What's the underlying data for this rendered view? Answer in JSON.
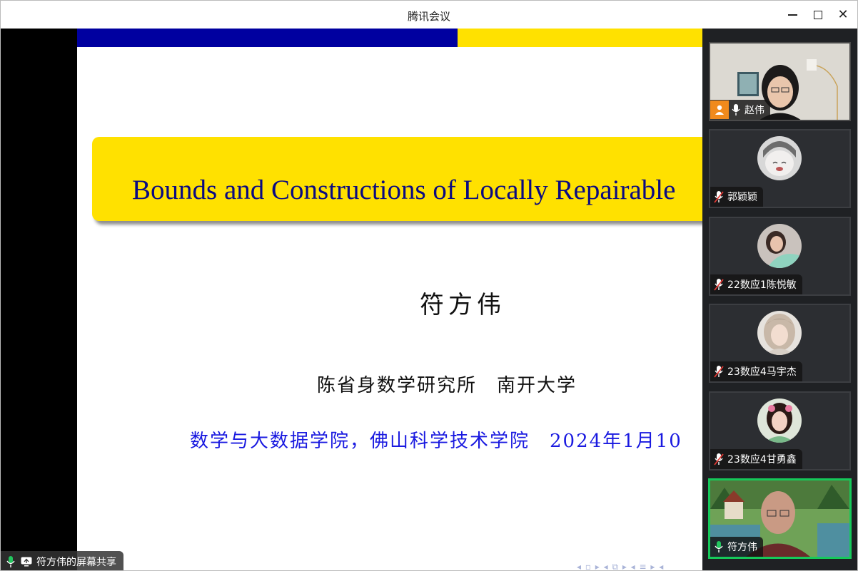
{
  "window": {
    "title": "腾讯会议",
    "minimize_icon": "minimize-icon",
    "maximize_icon": "maximize-icon",
    "close_icon": "close-icon",
    "close_glyph": "✕"
  },
  "slide": {
    "title": "Bounds and Constructions of Locally Repairable",
    "author": "符方伟",
    "affiliation_1": "陈省身数学研究所　南开大学",
    "affiliation_2": "数学与大数据学院，佛山科学技术学院　2024年1月10",
    "nav_symbols": "◂ ▫ ▸  ◂ ⧉ ▸  ◂ ≡ ▸ ◂",
    "colors": {
      "band_left": "#0000a0",
      "band_right": "#ffe100",
      "title_text": "#0a0a82",
      "affiliation_blue": "#1a1ae0"
    }
  },
  "participants": [
    {
      "name": "赵伟",
      "mic": "mic-on",
      "type": "video",
      "host_badge": true
    },
    {
      "name": "郭颖颖",
      "mic": "mic-muted",
      "type": "avatar"
    },
    {
      "name": "22数应1陈悦敏",
      "mic": "mic-muted",
      "type": "avatar"
    },
    {
      "name": "23数应4马宇杰",
      "mic": "mic-muted",
      "type": "avatar"
    },
    {
      "name": "23数应4甘勇鑫",
      "mic": "mic-muted",
      "type": "avatar"
    },
    {
      "name": "符方伟",
      "mic": "mic-on",
      "type": "video",
      "active_speaker": true
    }
  ],
  "screen_share": {
    "label": "符方伟的屏幕共享",
    "mic": "mic-on",
    "share_icon": "screen-share-icon"
  },
  "accent_colors": {
    "active_border": "#15c95a",
    "mic_on": "#22c55e",
    "mic_muted": "#e53935",
    "host_badge": "#f08a1c"
  }
}
